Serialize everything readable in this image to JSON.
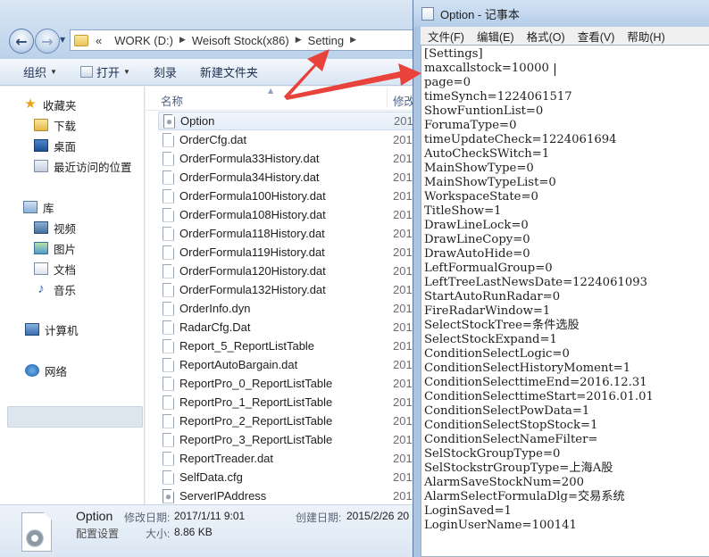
{
  "explorer": {
    "address_crumbs": [
      "«",
      "WORK (D:)",
      "Weisoft Stock(x86)",
      "Setting"
    ],
    "toolbar": [
      "组织",
      "打开",
      "刻录",
      "新建文件夹"
    ],
    "nav": {
      "favorites": "收藏夹",
      "downloads": "下载",
      "desktop": "桌面",
      "recent": "最近访问的位置",
      "libraries": "库",
      "videos": "视频",
      "pictures": "图片",
      "documents": "文档",
      "music": "音乐",
      "computer": "计算机",
      "network": "网络"
    },
    "columns": {
      "name": "名称",
      "date": "修改"
    },
    "files": [
      {
        "name": "Option",
        "date": "201"
      },
      {
        "name": "OrderCfg.dat",
        "date": "201"
      },
      {
        "name": "OrderFormula33History.dat",
        "date": "201"
      },
      {
        "name": "OrderFormula34History.dat",
        "date": "201"
      },
      {
        "name": "OrderFormula100History.dat",
        "date": "201"
      },
      {
        "name": "OrderFormula108History.dat",
        "date": "201"
      },
      {
        "name": "OrderFormula118History.dat",
        "date": "201"
      },
      {
        "name": "OrderFormula119History.dat",
        "date": "201"
      },
      {
        "name": "OrderFormula120History.dat",
        "date": "201"
      },
      {
        "name": "OrderFormula132History.dat",
        "date": "201"
      },
      {
        "name": "OrderInfo.dyn",
        "date": "201"
      },
      {
        "name": "RadarCfg.Dat",
        "date": "201"
      },
      {
        "name": "Report_5_ReportListTable",
        "date": "201"
      },
      {
        "name": "ReportAutoBargain.dat",
        "date": "201"
      },
      {
        "name": "ReportPro_0_ReportListTable",
        "date": "201"
      },
      {
        "name": "ReportPro_1_ReportListTable",
        "date": "201"
      },
      {
        "name": "ReportPro_2_ReportListTable",
        "date": "201"
      },
      {
        "name": "ReportPro_3_ReportListTable",
        "date": "201"
      },
      {
        "name": "ReportTreader.dat",
        "date": "201"
      },
      {
        "name": "SelfData.cfg",
        "date": "201"
      },
      {
        "name": "ServerIPAddress",
        "date": "201"
      }
    ],
    "details": {
      "name": "Option",
      "type": "配置设置",
      "modified_label": "修改日期:",
      "modified_value": "2017/1/11 9:01",
      "size_label": "大小:",
      "size_value": "8.86 KB",
      "created_label": "创建日期:",
      "created_value": "2015/2/26 20"
    }
  },
  "notepad": {
    "title": "Option - 记事本",
    "menus": [
      "文件(F)",
      "编辑(E)",
      "格式(O)",
      "查看(V)",
      "帮助(H)"
    ],
    "lines": [
      "[Settings]",
      "maxcallstock=10000",
      "page=0",
      "timeSynch=1224061517",
      "ShowFuntionList=0",
      "ForumaType=0",
      "timeUpdateCheck=1224061694",
      "AutoCheckSWitch=1",
      "MainShowType=0",
      "MainShowTypeList=0",
      "WorkspaceState=0",
      "TitleShow=1",
      "DrawLineLock=0",
      "DrawLineCopy=0",
      "DrawAutoHide=0",
      "LeftFormualGroup=0",
      "LeftTreeLastNewsDate=1224061093",
      "StartAutoRunRadar=0",
      "FireRadarWindow=1",
      "SelectStockTree=条件选股",
      "SelectStockExpand=1",
      "ConditionSelectLogic=0",
      "ConditionSelectHistoryMoment=1",
      "ConditionSelecttimeEnd=2016.12.31",
      "ConditionSelecttimeStart=2016.01.01",
      "ConditionSelectPowData=1",
      "ConditionSelectStopStock=1",
      "ConditionSelectNameFilter=",
      "SelStockGroupType=0",
      "SelStockstrGroupType=上海A股",
      "AlarmSaveStockNum=200",
      "AlarmSelectFormulaDlg=交易系统",
      "LoginSaved=1",
      "LoginUserName=100141"
    ]
  },
  "colors": {
    "arrow": "#e8423a",
    "selection": "#e4edf8"
  }
}
